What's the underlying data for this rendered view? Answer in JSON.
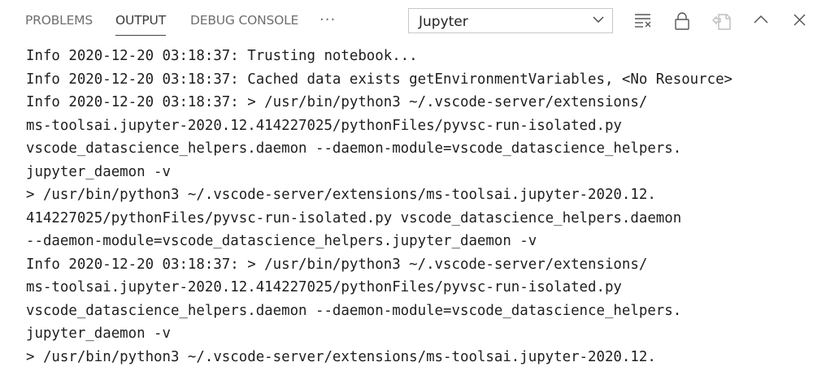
{
  "tabs": [
    {
      "label": "PROBLEMS"
    },
    {
      "label": "OUTPUT"
    },
    {
      "label": "DEBUG CONSOLE"
    }
  ],
  "more": "···",
  "channel_select": {
    "value": "Jupyter"
  },
  "toolbar": {
    "icons": [
      "clear-output-icon",
      "lock-scroll-icon",
      "open-log-file-icon",
      "maximize-panel-icon",
      "close-panel-icon"
    ]
  },
  "colors": {
    "active_tab": "#3b3b3b",
    "inactive_tab": "#6f6f6f",
    "text": "#1e1e1e"
  },
  "output_lines": [
    "Info 2020-12-20 03:18:37: Trusting notebook...",
    "Info 2020-12-20 03:18:37: Cached data exists getEnvironmentVariables, <No Resource>",
    "Info 2020-12-20 03:18:37: > /usr/bin/python3 ~/.vscode-server/extensions/",
    "ms-toolsai.jupyter-2020.12.414227025/pythonFiles/pyvsc-run-isolated.py",
    "vscode_datascience_helpers.daemon --daemon-module=vscode_datascience_helpers.",
    "jupyter_daemon -v",
    "> /usr/bin/python3 ~/.vscode-server/extensions/ms-toolsai.jupyter-2020.12.",
    "414227025/pythonFiles/pyvsc-run-isolated.py vscode_datascience_helpers.daemon",
    "--daemon-module=vscode_datascience_helpers.jupyter_daemon -v",
    "Info 2020-12-20 03:18:37: > /usr/bin/python3 ~/.vscode-server/extensions/",
    "ms-toolsai.jupyter-2020.12.414227025/pythonFiles/pyvsc-run-isolated.py",
    "vscode_datascience_helpers.daemon --daemon-module=vscode_datascience_helpers.",
    "jupyter_daemon -v",
    "> /usr/bin/python3 ~/.vscode-server/extensions/ms-toolsai.jupyter-2020.12."
  ]
}
